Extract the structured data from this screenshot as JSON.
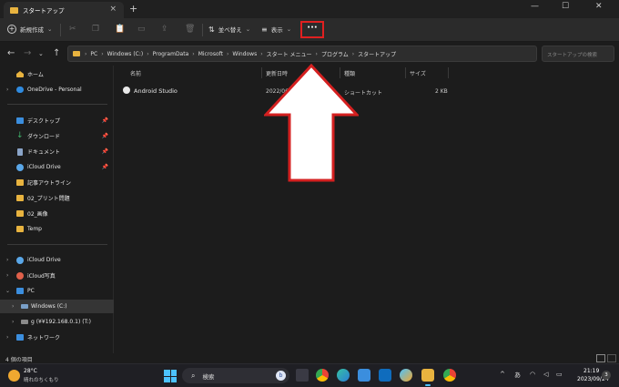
{
  "window": {
    "tab_title": "スタートアップ",
    "tab_close": "×",
    "new_tab": "+",
    "minimize": "—",
    "maximize": "☐",
    "close": "✕"
  },
  "toolbar": {
    "new_label": "新規作成",
    "new_symbol": "+",
    "sort_label": "並べ替え",
    "view_label": "表示",
    "more_label": "···"
  },
  "address": {
    "crumbs": [
      "PC",
      "Windows (C:)",
      "ProgramData",
      "Microsoft",
      "Windows",
      "スタート メニュー",
      "プログラム",
      "スタートアップ"
    ],
    "search_placeholder": "スタートアップの検索"
  },
  "sidebar": {
    "items": [
      {
        "label": "ホーム"
      },
      {
        "label": "OneDrive - Personal"
      },
      {
        "label": "デスクトップ"
      },
      {
        "label": "ダウンロード"
      },
      {
        "label": "ドキュメント"
      },
      {
        "label": "iCloud Drive"
      },
      {
        "label": "記事アウトライン"
      },
      {
        "label": "02_プリント問題"
      },
      {
        "label": "02_画像"
      },
      {
        "label": "Temp"
      },
      {
        "label": "iCloud Drive"
      },
      {
        "label": "iCloud写真"
      },
      {
        "label": "PC"
      },
      {
        "label": "Windows (C:)"
      },
      {
        "label": "g (¥¥192.168.0.1) (T:)"
      },
      {
        "label": "ネットワーク"
      }
    ]
  },
  "file_list": {
    "columns": [
      "名前",
      "更新日時",
      "種類",
      "サイズ"
    ],
    "rows": [
      {
        "name": "Android Studio",
        "modified": "2022/06/",
        "type": "ショートカット",
        "size": "2 KB"
      }
    ]
  },
  "status": {
    "item_count": "4 個の項目"
  },
  "taskbar": {
    "temperature": "28°C",
    "weather": "晴れのちくもり",
    "search_label": "検索",
    "time": "21:19",
    "date": "2023/09/24",
    "ime": "あ",
    "notifications": "3"
  },
  "colors": {
    "accent": "#4cc2ff",
    "folder": "#e8b33f",
    "highlight": "#e02020"
  }
}
